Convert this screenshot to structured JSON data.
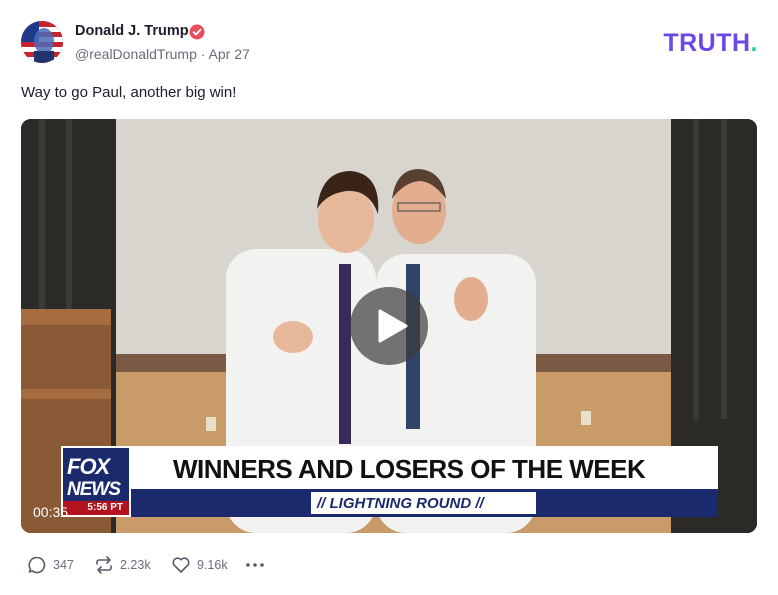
{
  "author": {
    "name": "Donald J. Trump",
    "handle": "@realDonaldTrump",
    "separator": "·",
    "date": "Apr 27",
    "verified_color": "#e84e5c"
  },
  "brand": {
    "name": "TRUTH",
    "dot": ".",
    "color": "#6b49e8",
    "dot_color": "#2fd0a8"
  },
  "post": {
    "text": "Way to go Paul, another big win!"
  },
  "video": {
    "duration": "00:35",
    "chyron": {
      "network_top": "FOX",
      "network_bottom": "NEWS",
      "time": "5:56 PT",
      "headline": "WINNERS AND LOSERS OF THE WEEK",
      "subline": "// LIGHTNING ROUND //"
    }
  },
  "actions": {
    "replies": {
      "icon": "comment-icon",
      "count": "347"
    },
    "retruths": {
      "icon": "repost-icon",
      "count": "2.23k"
    },
    "likes": {
      "icon": "heart-icon",
      "count": "9.16k"
    },
    "more": {
      "icon": "more-icon"
    }
  }
}
